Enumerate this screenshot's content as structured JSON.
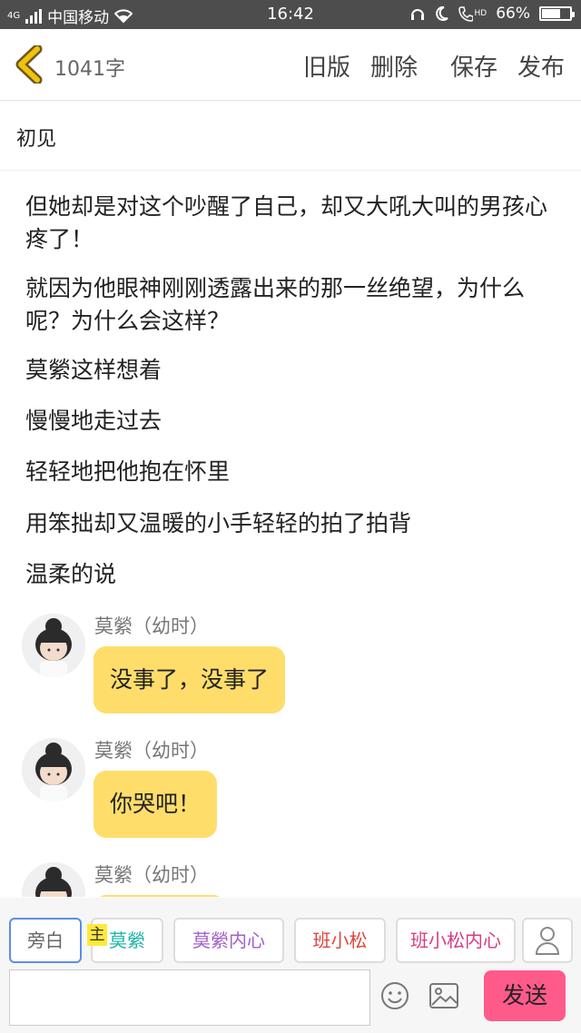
{
  "status_bar": {
    "network": "4G",
    "carrier": "中国移动",
    "time": "16:42",
    "hd": "HD",
    "battery": "66%",
    "battery_level": 0.66
  },
  "header": {
    "word_count": "1041字",
    "actions": [
      "旧版",
      "删除",
      "保存",
      "发布"
    ]
  },
  "title": "初见",
  "paragraphs": [
    "但她却是对这个吵醒了自己，却又大吼大叫的男孩心疼了！",
    "就因为他眼神刚刚透露出来的那一丝绝望，为什么呢？为什么会这样？",
    "莫縈这样想着",
    "慢慢地走过去",
    "轻轻地把他抱在怀里",
    "用笨拙却又温暖的小手轻轻的拍了拍背",
    "温柔的说"
  ],
  "messages": [
    {
      "speaker": "莫縈（幼时）",
      "text": "没事了，没事了"
    },
    {
      "speaker": "莫縈（幼时）",
      "text": "你哭吧！"
    },
    {
      "speaker": "莫縈（幼时）",
      "text": ""
    }
  ],
  "roles": [
    {
      "label": "旁白",
      "color": "#666666"
    },
    {
      "label": "莫縈",
      "color": "#1ab5a5"
    },
    {
      "label": "莫縈内心",
      "color": "#a35ec9"
    },
    {
      "label": "班小松",
      "color": "#e0453a"
    },
    {
      "label": "班小松内心",
      "color": "#d63c82"
    }
  ],
  "main_badge": "主",
  "input": {
    "placeholder": "",
    "send_label": "发送"
  },
  "colors": {
    "bubble": "#ffdd6b",
    "send": "#ff5b8a",
    "back_arrow": "#f2c20e"
  }
}
